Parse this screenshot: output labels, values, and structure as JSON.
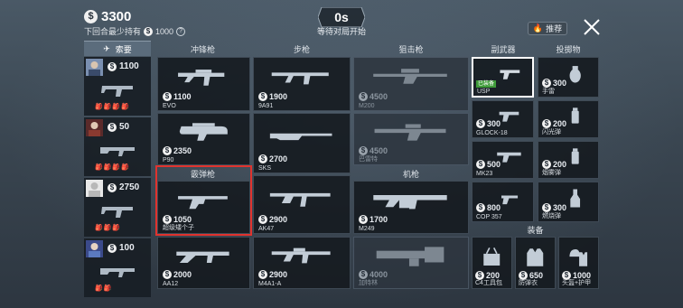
{
  "header": {
    "currency": "$",
    "money": "3300",
    "min_hold_label": "下回合最少持有",
    "min_hold_value": "1000",
    "help": "?",
    "countdown": "0s",
    "status": "等待对局开始",
    "recommend": "推荐"
  },
  "loadout": {
    "sort_label": "索要",
    "players": [
      {
        "amount": "1100",
        "items": "🎒🎒🎒🎒"
      },
      {
        "amount": "50",
        "items": "🎒🎒🎒🎒"
      },
      {
        "amount": "2750",
        "items": "🎒🎒🎒"
      },
      {
        "amount": "100",
        "items": "🎒🎒"
      }
    ]
  },
  "categories": {
    "smg": "冲锋枪",
    "rifle": "步枪",
    "sniper": "狙击枪",
    "pistol": "副武器",
    "throwable": "投掷物",
    "shotgun": "霰弹枪",
    "lmg": "机枪",
    "equipment": "装备"
  },
  "weapons": {
    "evo": {
      "price": "1100",
      "name": "EVO"
    },
    "p90": {
      "price": "2350",
      "name": "P90"
    },
    "shotgun1": {
      "price": "1050",
      "name": "超级矮个子"
    },
    "aa12": {
      "price": "2000",
      "name": "AA12"
    },
    "9a91": {
      "price": "1900",
      "name": "9A91"
    },
    "sks": {
      "price": "2700",
      "name": "SKS"
    },
    "ak47": {
      "price": "2900",
      "name": "AK47"
    },
    "m4a1": {
      "price": "2900",
      "name": "M4A1-A"
    },
    "m200": {
      "price": "4500",
      "name": "M200"
    },
    "sniper2": {
      "price": "4500",
      "name": "巴雷特"
    },
    "m249": {
      "price": "1700",
      "name": "M249"
    },
    "minigun": {
      "price": "4000",
      "name": "加特林"
    },
    "usp": {
      "badge": "已装备",
      "name": "USP"
    },
    "glock": {
      "price": "300",
      "name": "GLOCK-18"
    },
    "mk23": {
      "price": "500",
      "name": "MK23"
    },
    "cop357": {
      "price": "800",
      "name": "COP 357"
    },
    "grenade": {
      "price": "300",
      "name": "手雷"
    },
    "flash": {
      "price": "200",
      "name": "闪光弹"
    },
    "smoke": {
      "price": "200",
      "name": "烟雾弹"
    },
    "molotov": {
      "price": "300",
      "name": "燃烧弹"
    },
    "c4kit": {
      "price": "200",
      "name": "C4工具包"
    },
    "vest": {
      "price": "650",
      "name": "防弹衣"
    },
    "helmet": {
      "price": "1000",
      "name": "头盔+护甲"
    }
  }
}
